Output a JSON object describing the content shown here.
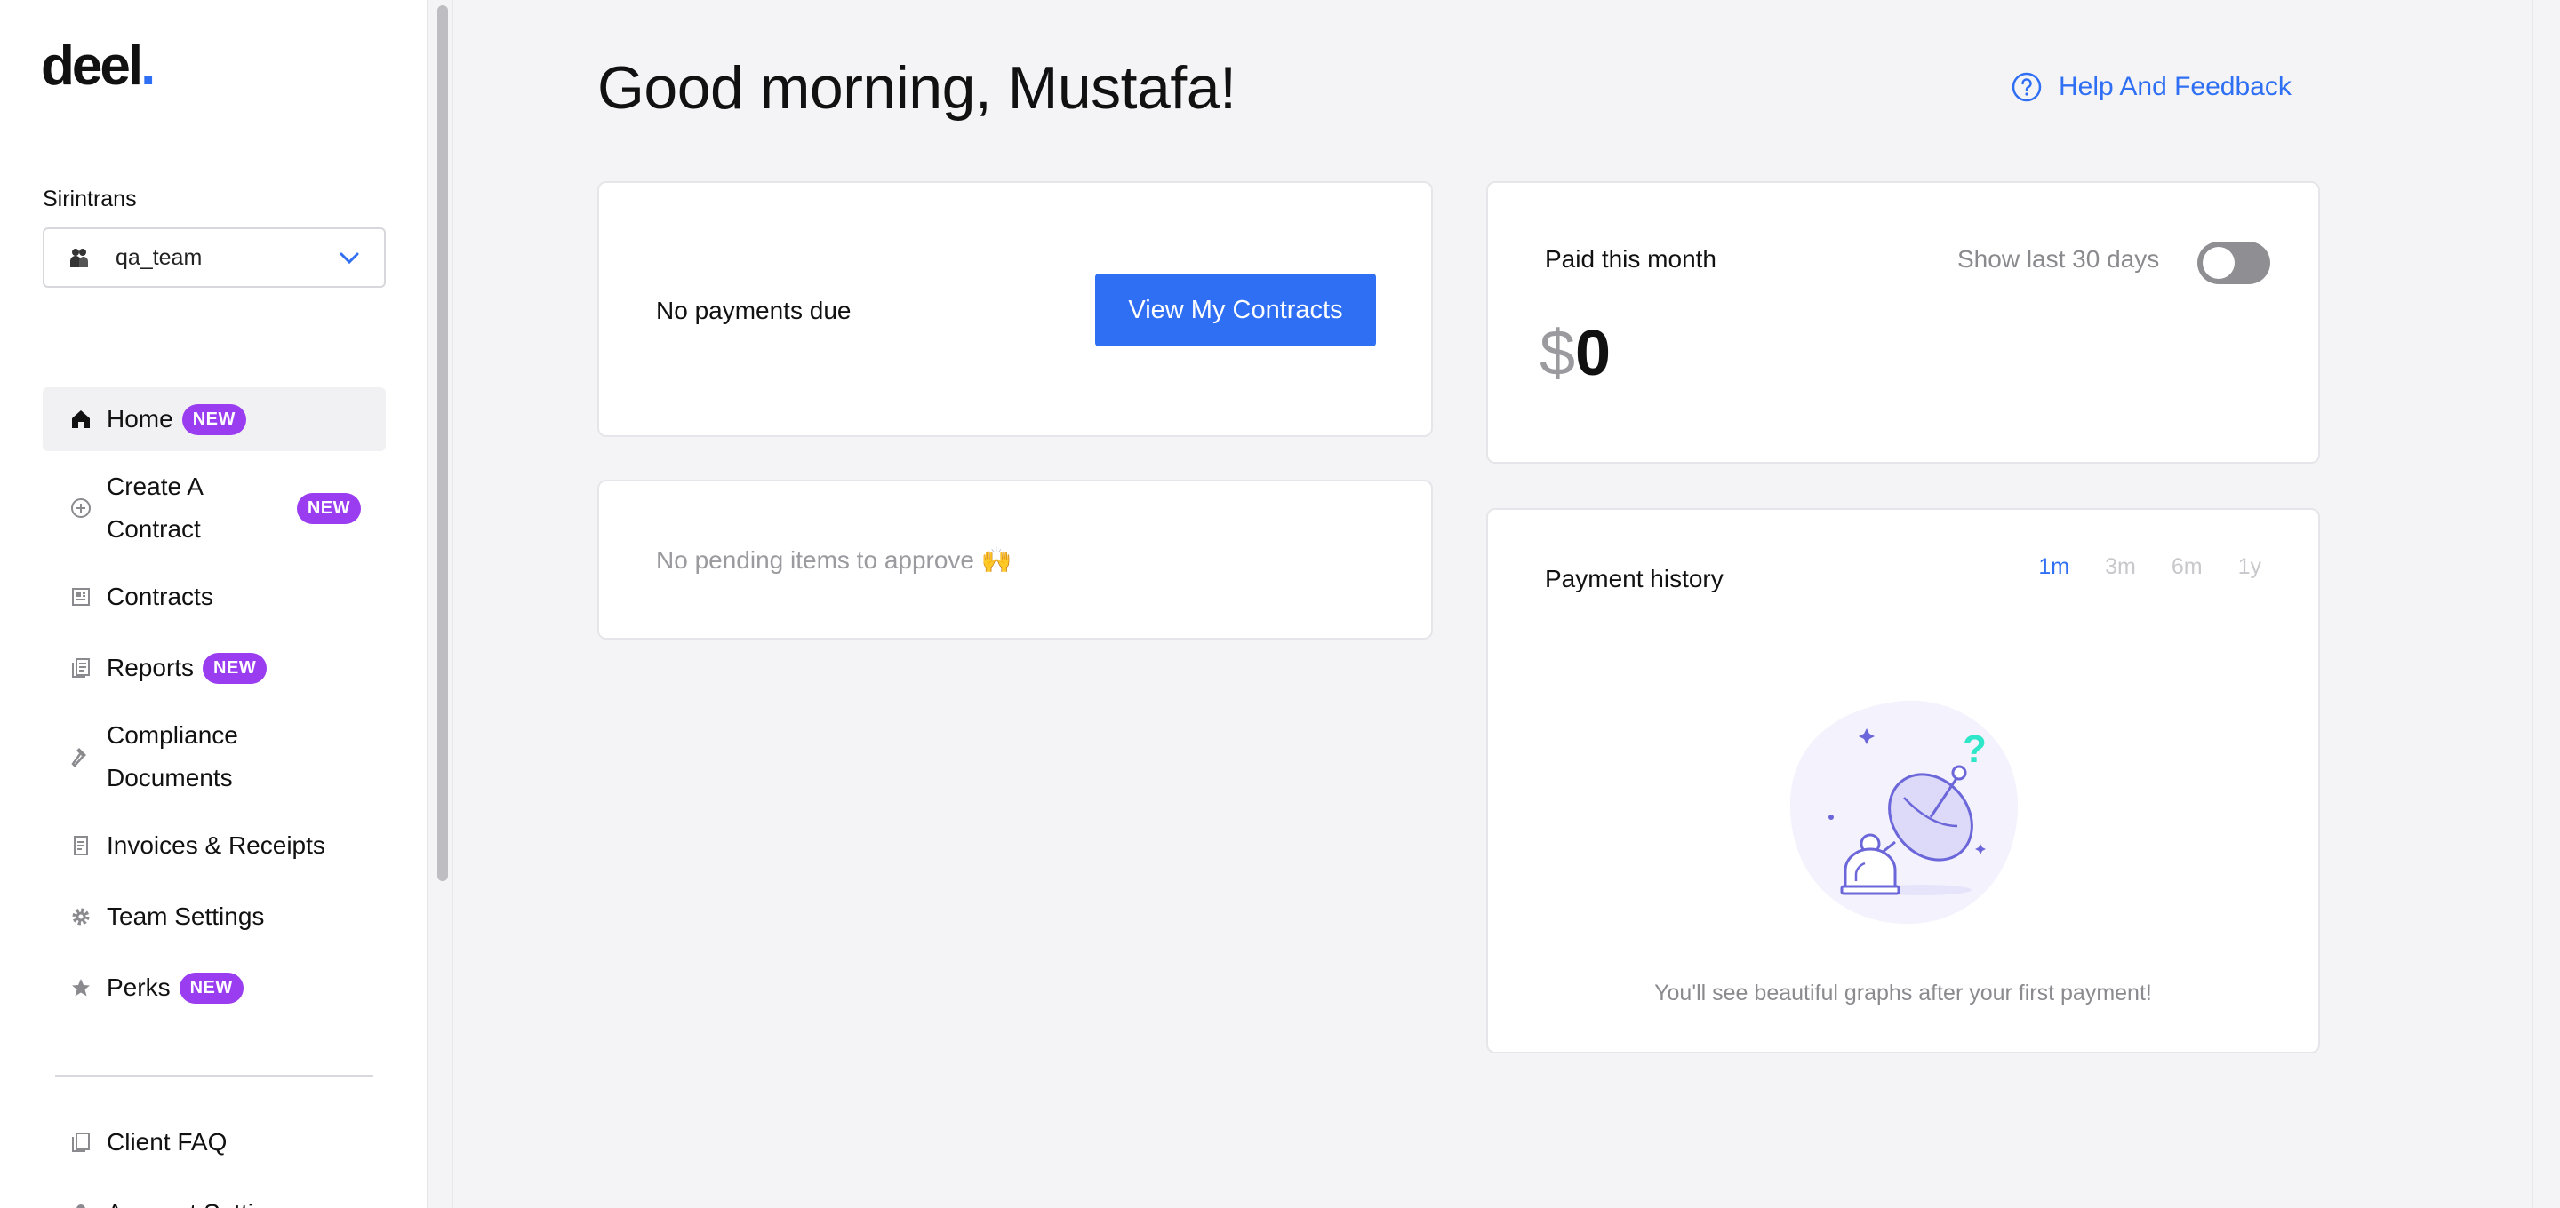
{
  "brand": {
    "logo_text": "deel",
    "logo_dot": ".",
    "accent": "#2f6ff4",
    "badge_color": "#9a3cf0"
  },
  "sidebar": {
    "org_label": "Sirintrans",
    "team_select": {
      "value": "qa_team"
    },
    "items": [
      {
        "label": "Home",
        "icon": "home-icon",
        "badge": "NEW",
        "active": true
      },
      {
        "label": "Create A Contract",
        "icon": "plus-circle-icon",
        "badge": "NEW"
      },
      {
        "label": "Contracts",
        "icon": "contract-icon"
      },
      {
        "label": "Reports",
        "icon": "reports-icon",
        "badge": "NEW"
      },
      {
        "label": "Compliance Documents",
        "icon": "gavel-icon"
      },
      {
        "label": "Invoices & Receipts",
        "icon": "receipt-icon"
      },
      {
        "label": "Team Settings",
        "icon": "gear-icon"
      },
      {
        "label": "Perks",
        "icon": "star-icon",
        "badge": "NEW"
      }
    ],
    "bottom_items": [
      {
        "label": "Client FAQ",
        "icon": "faq-icon"
      },
      {
        "label": "Account Settings",
        "icon": "user-icon"
      }
    ]
  },
  "header": {
    "greeting": "Good morning, Mustafa!",
    "help_label": "Help And Feedback"
  },
  "payments_card": {
    "label": "No payments due",
    "button_label": "View My Contracts"
  },
  "approve_card": {
    "label": "No pending items to approve 🙌"
  },
  "paid_card": {
    "title": "Paid this month",
    "toggle_label": "Show last 30 days",
    "toggle_on": false,
    "currency": "$",
    "amount": "0"
  },
  "history_card": {
    "title": "Payment history",
    "periods": [
      "1m",
      "3m",
      "6m",
      "1y"
    ],
    "selected_period": "1m",
    "empty_text": "You'll see beautiful graphs after your first payment!"
  }
}
